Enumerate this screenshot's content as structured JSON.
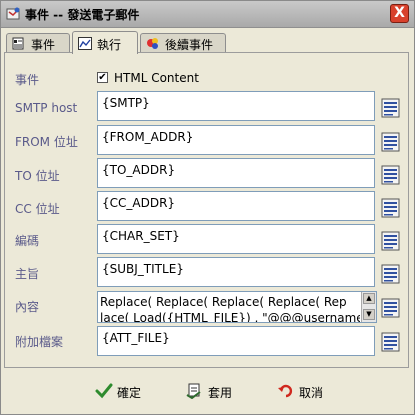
{
  "window": {
    "title": "事件 -- 發送電子郵件",
    "close_symbol": "X"
  },
  "tabs": [
    {
      "label": "事件",
      "icon": "event-icon",
      "active": false
    },
    {
      "label": "執行",
      "icon": "execute-icon",
      "active": true
    },
    {
      "label": "後續事件",
      "icon": "next-event-icon",
      "active": false
    }
  ],
  "form": {
    "event": {
      "label": "事件",
      "checkbox_label": "HTML Content",
      "checked": true,
      "check_mark": "✔"
    },
    "smtp_host": {
      "label": "SMTP host",
      "value": "{SMTP}"
    },
    "from_addr": {
      "label": "FROM 位址",
      "value": "{FROM_ADDR}"
    },
    "to_addr": {
      "label": "TO 位址",
      "value": "{TO_ADDR}"
    },
    "cc_addr": {
      "label": "CC 位址",
      "value": "{CC_ADDR}"
    },
    "charset": {
      "label": "編碼",
      "value": "{CHAR_SET}"
    },
    "subject": {
      "label": "主旨",
      "value": "{SUBJ_TITLE}"
    },
    "content": {
      "label": "內容",
      "line1": "    Replace(  Replace(  Replace( Replace( Rep",
      "line2": "lace( Load({HTML_FILE}) , \"@@@username@"
    },
    "attachment": {
      "label": "附加檔案",
      "value": "{ATT_FILE}"
    }
  },
  "buttons": {
    "ok": {
      "label": "確定",
      "icon": "checkmark-icon",
      "color": "#2e8b2e"
    },
    "apply": {
      "label": "套用",
      "icon": "apply-icon"
    },
    "cancel": {
      "label": "取消",
      "icon": "undo-icon",
      "color": "#d0281e"
    }
  }
}
